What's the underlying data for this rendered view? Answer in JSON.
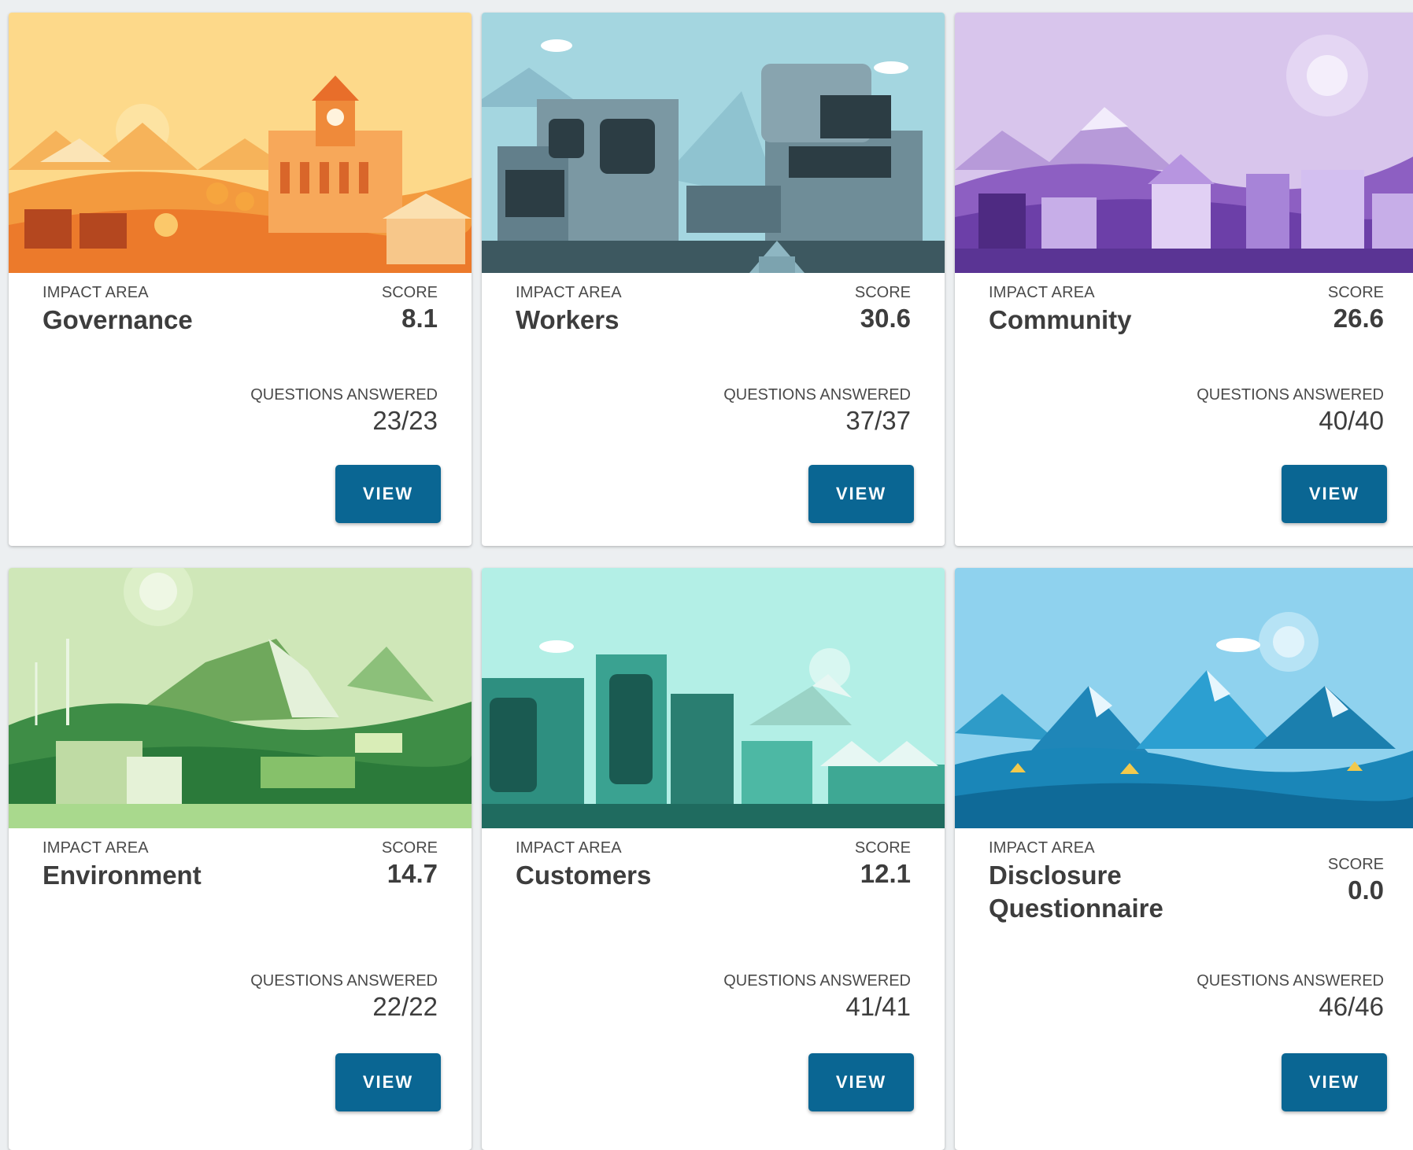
{
  "colors": {
    "button": "#0a6693",
    "background": "#eceff1",
    "card": "#ffffff"
  },
  "cards": [
    {
      "theme": "orange-town-illustration",
      "impact_label": "IMPACT AREA",
      "impact_area": "Governance",
      "score_label": "SCORE",
      "score": "8.1",
      "qa_label": "QUESTIONS ANSWERED",
      "questions_answered": "23/23",
      "button_label": "VIEW"
    },
    {
      "theme": "grey-blue-buildings-illustration",
      "impact_label": "IMPACT AREA",
      "impact_area": "Workers",
      "score_label": "SCORE",
      "score": "30.6",
      "qa_label": "QUESTIONS ANSWERED",
      "questions_answered": "37/37",
      "button_label": "VIEW"
    },
    {
      "theme": "purple-village-illustration",
      "impact_label": "IMPACT AREA",
      "impact_area": "Community",
      "score_label": "SCORE",
      "score": "26.6",
      "qa_label": "QUESTIONS ANSWERED",
      "questions_answered": "40/40",
      "button_label": "VIEW"
    },
    {
      "theme": "green-hills-windmill-illustration",
      "impact_label": "IMPACT AREA",
      "impact_area": "Environment",
      "score_label": "SCORE",
      "score": "14.7",
      "qa_label": "QUESTIONS ANSWERED",
      "questions_answered": "22/22",
      "button_label": "VIEW"
    },
    {
      "theme": "teal-city-illustration",
      "impact_label": "IMPACT AREA",
      "impact_area": "Customers",
      "score_label": "SCORE",
      "score": "12.1",
      "qa_label": "QUESTIONS ANSWERED",
      "questions_answered": "41/41",
      "button_label": "VIEW"
    },
    {
      "theme": "blue-mountains-illustration",
      "impact_label": "IMPACT AREA",
      "impact_area": "Disclosure Questionnaire",
      "score_label": "SCORE",
      "score": "0.0",
      "qa_label": "QUESTIONS ANSWERED",
      "questions_answered": "46/46",
      "button_label": "VIEW"
    }
  ]
}
